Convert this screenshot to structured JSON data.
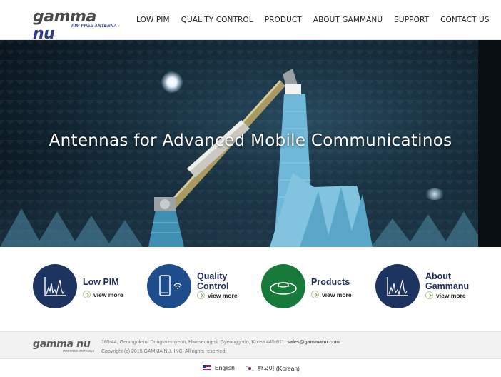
{
  "brand": {
    "logo_main": "gamma",
    "logo_accent": "nu",
    "logo_tagline": "PIM FREE ANTENNA"
  },
  "nav": {
    "items": [
      "LOW PIM",
      "QUALITY CONTROL",
      "PRODUCT",
      "ABOUT GAMMANU",
      "SUPPORT",
      "CONTACT US"
    ]
  },
  "hero": {
    "title": "Antennas for Advanced Mobile Communicatinos"
  },
  "features": [
    {
      "title_line1": "Low PIM",
      "title_line2": "",
      "more": "view more",
      "color": "#1e3460",
      "icon": "pim-chart-icon"
    },
    {
      "title_line1": "Quality",
      "title_line2": "Control",
      "more": "view more",
      "color": "#1e4d8c",
      "icon": "smartphone-wifi-icon"
    },
    {
      "title_line1": "Products",
      "title_line2": "",
      "more": "view more",
      "color": "#177a3a",
      "icon": "antenna-disc-icon"
    },
    {
      "title_line1": "About",
      "title_line2": "Gammanu",
      "more": "view more",
      "color": "#1e3460",
      "icon": "pim-chart-icon"
    }
  ],
  "footer": {
    "logo_main": "gamma nu",
    "logo_tagline": "PIM FREE ANTENNA",
    "address": "185-44, Geumgok-ro, Dongtan-myeon, Hwaseong-si, Gyeonggi-do, Korea 445-811.",
    "email": "sales@gammanu.com",
    "copyright": "Copyright (c) 2015 GAMMA NU, INC. All rights reserved."
  },
  "languages": [
    {
      "label": "English",
      "flag": "us-flag-icon"
    },
    {
      "label": "한국어 (Korean)",
      "flag": "kr-flag-icon"
    }
  ]
}
